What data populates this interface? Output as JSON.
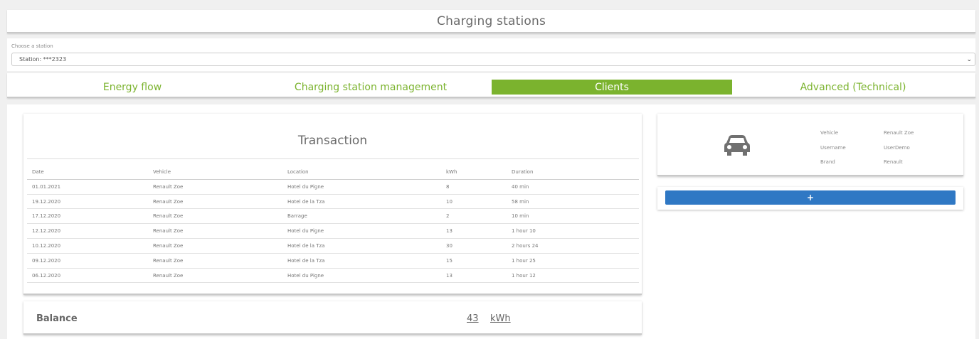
{
  "header": {
    "title": "Charging stations"
  },
  "station": {
    "label": "Choose a station",
    "selected": "Station: ***2323"
  },
  "tabs": [
    {
      "label": "Energy flow",
      "active": false
    },
    {
      "label": "Charging station management",
      "active": false
    },
    {
      "label": "Clients",
      "active": true
    },
    {
      "label": "Advanced (Technical)",
      "active": false
    }
  ],
  "transaction": {
    "title": "Transaction",
    "columns": [
      "Date",
      "Vehicle",
      "Location",
      "kWh",
      "Duration"
    ],
    "rows": [
      [
        "01.01.2021",
        "Renault Zoe",
        "Hotel du Pigne",
        "8",
        "40 min"
      ],
      [
        "19.12.2020",
        "Renault Zoe",
        "Hotel de la Tza",
        "10",
        "58 min"
      ],
      [
        "17.12.2020",
        "Renault Zoe",
        "Barrage",
        "2",
        "10 min"
      ],
      [
        "12.12.2020",
        "Renault Zoe",
        "Hotel du Pigne",
        "13",
        "1 hour 10"
      ],
      [
        "10.12.2020",
        "Renault Zoe",
        "Hotel de la Tza",
        "30",
        "2 hours 24"
      ],
      [
        "09.12.2020",
        "Renault Zoe",
        "Hotel de la Tza",
        "15",
        "1 hour 25"
      ],
      [
        "06.12.2020",
        "Renault Zoe",
        "Hotel du Pigne",
        "13",
        "1 hour 12"
      ]
    ]
  },
  "balance": {
    "label": "Balance",
    "value": "43",
    "unit": "kWh"
  },
  "vehicle": {
    "icon": "car-icon",
    "vehicle_label": "Vehicle",
    "vehicle_value": "Renault Zoe",
    "username_label": "Username",
    "username_value": "UserDemo",
    "brand_label": "Brand",
    "brand_value": "Renault"
  },
  "add_button": {
    "label": "+"
  },
  "colors": {
    "accent_green": "#7bb32e",
    "button_blue": "#2f78c4"
  }
}
